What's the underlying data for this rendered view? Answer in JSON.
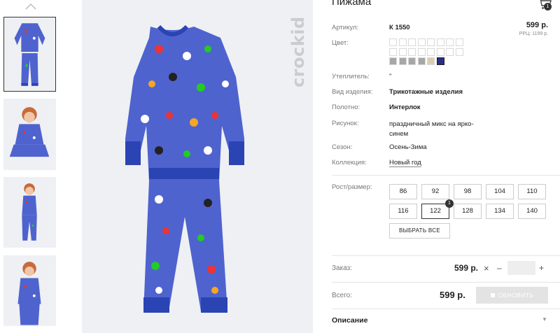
{
  "product": {
    "title": "Пижама",
    "cart_count": "1",
    "brand_logo_text": "crockid",
    "price": "599 р.",
    "rrp": "РРЦ: 1199 р."
  },
  "attributes": [
    {
      "label": "Артикул:",
      "value": "К 1550"
    },
    {
      "label": "Цвет:",
      "value": ""
    },
    {
      "label": "Утеплитель:",
      "value": "\""
    },
    {
      "label": "Вид изделия:",
      "value": "Трикотажные изделия"
    },
    {
      "label": "Полотно:",
      "value": "Интерлок"
    },
    {
      "label": "Рисунок:",
      "value": "праздничный микс на ярко-синем"
    },
    {
      "label": "Сезон:",
      "value": "Осень-Зима"
    },
    {
      "label": "Коллекция:",
      "value": "Новый год"
    }
  ],
  "color_swatches": {
    "colors": [
      "#ffffff",
      "#ffffff",
      "#ffffff",
      "#ffffff",
      "#ffffff",
      "#ffffff",
      "#ffffff",
      "#ffffff",
      "#ffffff",
      "#ffffff",
      "#ffffff",
      "#ffffff",
      "#ffffff",
      "#ffffff",
      "#ffffff",
      "#ffffff",
      "#a7a7a7",
      "#a7a7a7",
      "#a7a7a7",
      "#a7a7a7",
      "#d9cfb0",
      "#2a2d8a"
    ],
    "selected_index": 21
  },
  "sizes": {
    "label": "Рост/размер:",
    "items": [
      "86",
      "92",
      "98",
      "104",
      "110",
      "116",
      "122",
      "128",
      "134",
      "140"
    ],
    "selected": "122",
    "selected_badge": "1",
    "choose_all": "ВЫБРАТЬ ВСЕ"
  },
  "order": {
    "label": "Заказ:",
    "price": "599 р.",
    "remove_icon": "×",
    "minus": "–",
    "plus": "+",
    "quantity_value": ""
  },
  "total": {
    "label": "Всего:",
    "price": "599 р.",
    "update_button": "ОБНОВИТЬ"
  },
  "description": {
    "label": "Описание"
  },
  "colors": {
    "pajama": "#4f63cf",
    "cuff": "#2a44b3",
    "bg": "#eef0f3"
  }
}
